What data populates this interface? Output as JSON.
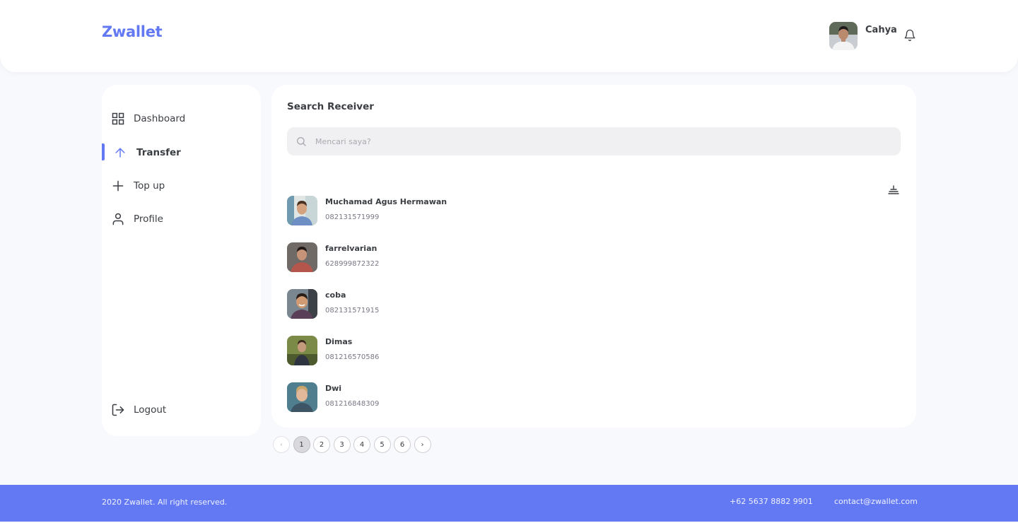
{
  "header": {
    "brand": "Zwallet",
    "user_name": "Cahya"
  },
  "colors": {
    "accent": "#6379f4",
    "background": "#f8f9fc",
    "card": "#ffffff",
    "text": "#3a3d42"
  },
  "sidebar": {
    "items": [
      {
        "label": "Dashboard",
        "icon": "grid-icon",
        "active": false
      },
      {
        "label": "Transfer",
        "icon": "arrow-up-icon",
        "active": true
      },
      {
        "label": "Top up",
        "icon": "plus-icon",
        "active": false
      },
      {
        "label": "Profile",
        "icon": "user-icon",
        "active": false
      }
    ],
    "logout_label": "Logout"
  },
  "main": {
    "title": "Search Receiver",
    "search": {
      "placeholder": "Mencari saya?",
      "value": ""
    },
    "contacts": [
      {
        "name": "Muchamad Agus Hermawan",
        "phone": "082131571999"
      },
      {
        "name": "farrelvarian",
        "phone": "628999872322"
      },
      {
        "name": "coba",
        "phone": "082131571915"
      },
      {
        "name": "Dimas",
        "phone": "081216570586"
      },
      {
        "name": "Dwi",
        "phone": "081216848309"
      }
    ]
  },
  "pagination": {
    "prev": "‹",
    "pages": [
      "1",
      "2",
      "3",
      "4",
      "5",
      "6"
    ],
    "current": "1",
    "next": "›"
  },
  "footer": {
    "copyright": "2020 Zwallet. All right reserved.",
    "phone": "+62 5637 8882 9901",
    "email": "contact@zwallet.com"
  }
}
